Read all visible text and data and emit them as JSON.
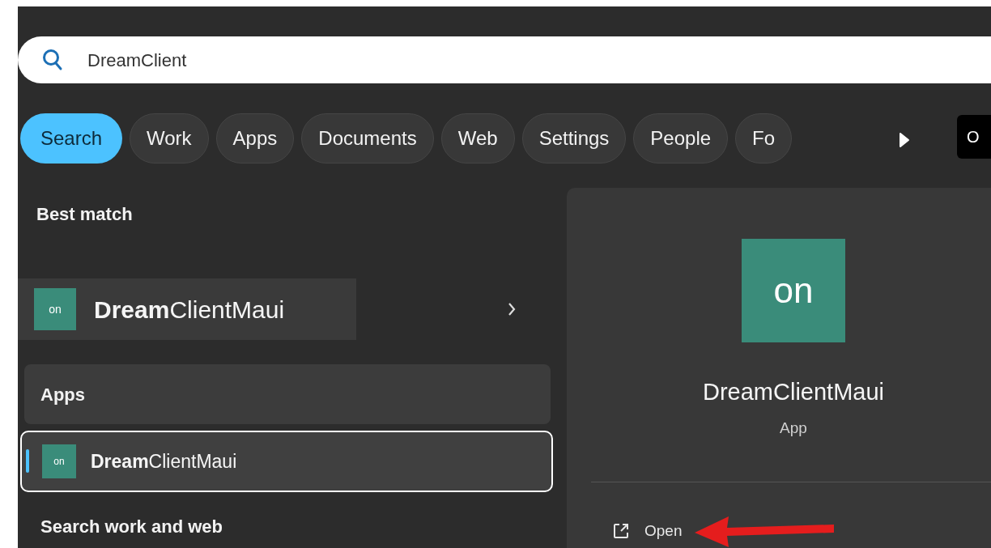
{
  "search": {
    "value": "DreamClient"
  },
  "filters": [
    {
      "label": "Search",
      "selected": true
    },
    {
      "label": "Work",
      "selected": false
    },
    {
      "label": "Apps",
      "selected": false
    },
    {
      "label": "Documents",
      "selected": false
    },
    {
      "label": "Web",
      "selected": false
    },
    {
      "label": "Settings",
      "selected": false
    },
    {
      "label": "People",
      "selected": false
    },
    {
      "label": "Fo",
      "selected": false
    }
  ],
  "account_badge": "O",
  "best_match": {
    "heading": "Best match",
    "name": "**Dream**ClientMaui",
    "icon_text": "on"
  },
  "apps": {
    "heading": "Apps",
    "items": [
      {
        "name": "**Dream**ClientMaui",
        "icon_text": "on",
        "selected": true
      }
    ]
  },
  "search_web_heading": "Search work and web",
  "details": {
    "icon_text": "on",
    "title": "DreamClientMaui",
    "subtitle": "App",
    "actions": [
      {
        "label": "Open"
      }
    ]
  }
}
